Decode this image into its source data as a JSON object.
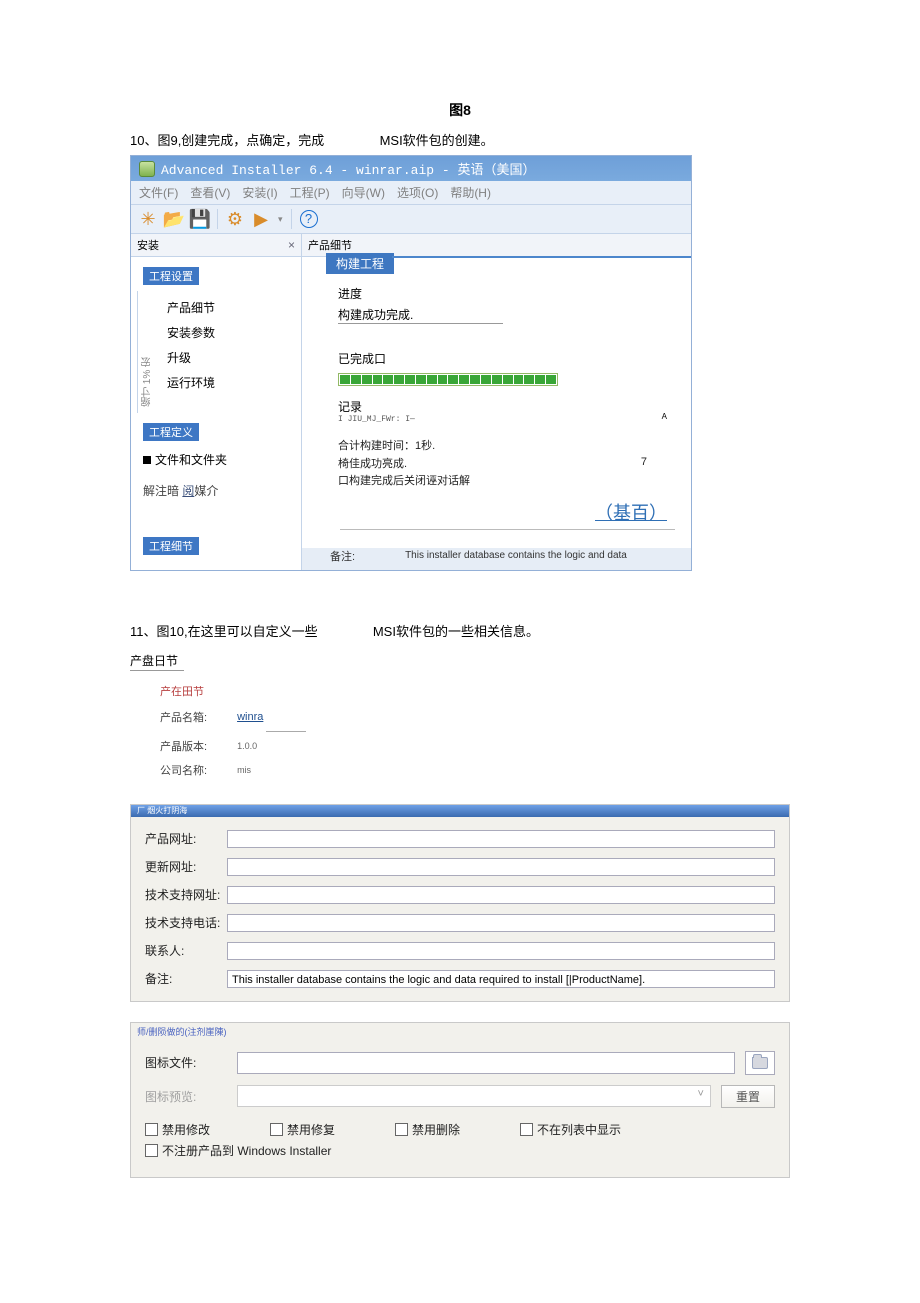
{
  "caption_fig8": "图8",
  "step10": {
    "prefix": "10、图9,创建完成，点确定，完成",
    "suffix": "MSI软件包的创建。"
  },
  "app": {
    "title": "Advanced Installer 6.4 - winrar.aip - 英语（美国）",
    "menu": {
      "file": "文件(F)",
      "view": "查看(V)",
      "install": "安装(I)",
      "project": "工程(P)",
      "wizard": "向导(W)",
      "options": "选项(O)",
      "help": "帮助(H)"
    },
    "left": {
      "panel_title": "安装",
      "sec_project_settings": "工程设置",
      "vertical": "缩寸 1% 宏",
      "items": {
        "product_detail": "产品细节",
        "install_params": "安装参数",
        "upgrade": "升级",
        "runtime": "运行环境"
      },
      "sec_project_def": "工程定义",
      "files_folders": "文件和文件夹",
      "notes_line_prefix": "解注暗 ",
      "notes_line_link": "阅",
      "notes_line_suffix": "媒介",
      "sec_project_detail": "工程细节"
    },
    "content": {
      "tab_header": "产品细节",
      "build_tab": "构建工程",
      "progress_label": "进度",
      "progress_text": "构建成功完成.",
      "done_label": "已完成口",
      "log_label": "记录",
      "log_line": "I JIU_MJ_FWr: I—",
      "log_a": "A",
      "sum_line1": "合计构建时间：1秒.",
      "sum_line2": "椅佳成功亮成.",
      "sum_n7": "7",
      "sum_close_cb": "口构建完成后关闭诬对话解",
      "link_text": "（基百）",
      "remark_label": "备注:",
      "remark_value": "This installer database contains the logic and data"
    }
  },
  "step11": {
    "prefix": "11、图10,在这里可以自定义一些",
    "suffix": "MSI软件包的一些相关信息。"
  },
  "section11_header1": "产盘日节",
  "details": {
    "header": "产在田节",
    "rows": {
      "name_lbl": "产品名箱:",
      "name_val": "winra",
      "version_lbl": "产晶版本:",
      "version_val": "1.0.0",
      "company_lbl": "公司名称:",
      "company_val": "mis"
    }
  },
  "form": {
    "panel_title": "厂 烟火打阴海",
    "product_url": "产品网址:",
    "update_url": "更新网址:",
    "support_url": "技术支持网址:",
    "support_tel": "技术支持电话:",
    "contact": "联系人:",
    "remark": "备注:",
    "remark_val": "This installer database contains the logic and data required to install [|ProductName]."
  },
  "icon_panel": {
    "sec_title": "师/删陨做的(注剂崖陳)",
    "icon_file": "图标文件:",
    "icon_preview": "图标预览:",
    "reset_btn": "重置",
    "cb_disable_modify": "禁用修改",
    "cb_disable_repair": "禁用修复",
    "cb_disable_delete": "禁用删除",
    "cb_hide_in_list": "不在列表中显示",
    "cb_no_register": "不注册产品到 Windows Installer"
  }
}
